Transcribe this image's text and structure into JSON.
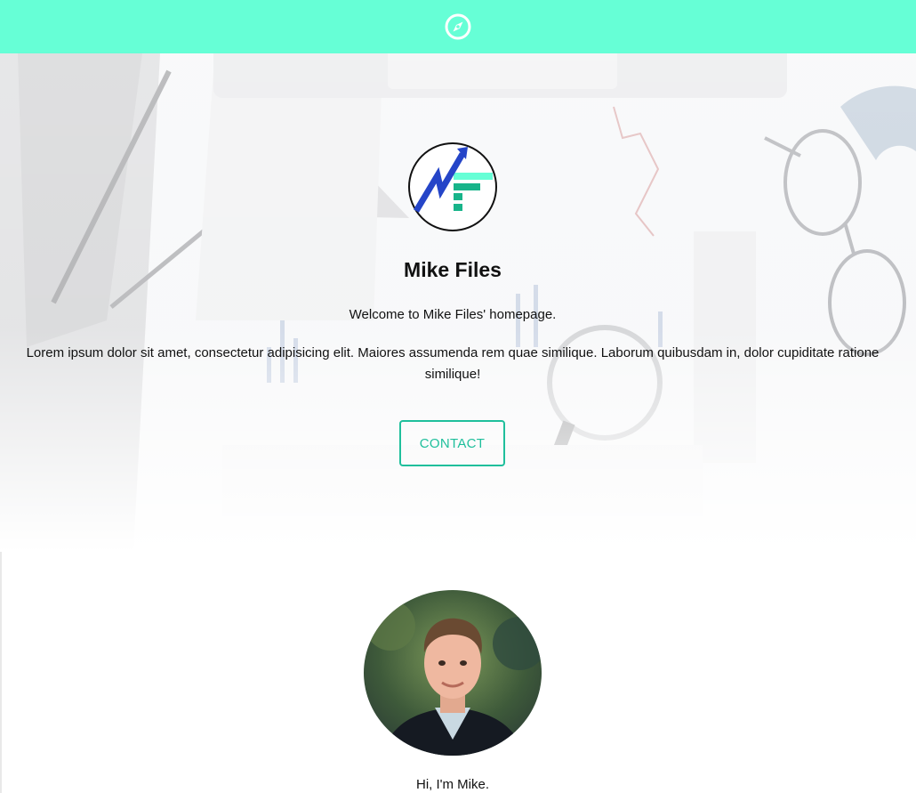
{
  "theme": {
    "accent": "#66ffd6",
    "button_color": "#1fbf9c",
    "logo_blue": "#2545c8",
    "logo_green": "#18b48a"
  },
  "header": {
    "icon": "compass-icon"
  },
  "hero": {
    "logo": "mike-files-logo",
    "title": "Mike Files",
    "welcome": "Welcome to Mike Files' homepage.",
    "description": "Lorem ipsum dolor sit amet, consectetur adipisicing elit. Maiores assumenda rem quae similique. Laborum quibusdam in, dolor cupiditate ratione similique!",
    "contact_label": "CONTACT"
  },
  "about": {
    "avatar": "profile-photo",
    "intro": "Hi, I'm Mike."
  }
}
